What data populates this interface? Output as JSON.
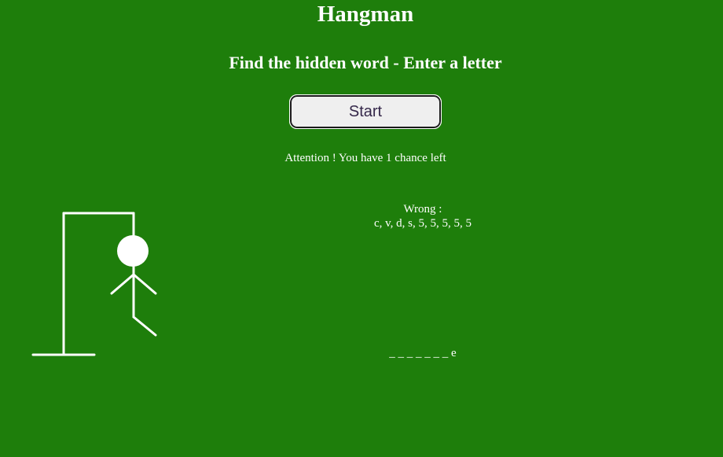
{
  "header": {
    "title": "Hangman",
    "subtitle": "Find the hidden word - Enter a letter"
  },
  "controls": {
    "start_label": "Start"
  },
  "status": {
    "attention_text": "Attention ! You have 1 chance left"
  },
  "wrong": {
    "label": "Wrong :",
    "letters": "c, v, d, s, 5, 5, 5, 5, 5"
  },
  "word": {
    "display": "_ _ _ _ _ _ _ e"
  },
  "colors": {
    "background": "#1e7e0b",
    "text": "#ffffff",
    "button_bg": "#efefef",
    "button_text": "#35284a"
  }
}
